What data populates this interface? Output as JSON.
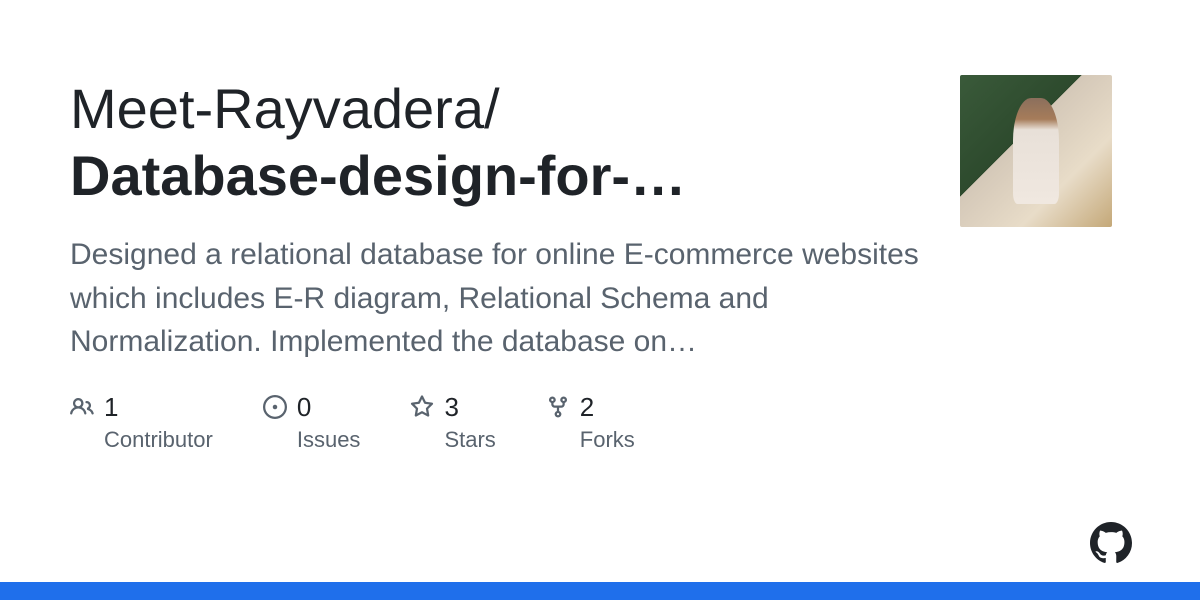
{
  "repo": {
    "owner": "Meet-Rayvadera",
    "name": "Database-design-for-…",
    "description": "Designed a relational database for online E-commerce websites which includes E-R diagram, Relational Schema and Normalization. Implemented the database on…"
  },
  "stats": {
    "contributors": {
      "value": "1",
      "label": "Contributor"
    },
    "issues": {
      "value": "0",
      "label": "Issues"
    },
    "stars": {
      "value": "3",
      "label": "Stars"
    },
    "forks": {
      "value": "2",
      "label": "Forks"
    }
  }
}
